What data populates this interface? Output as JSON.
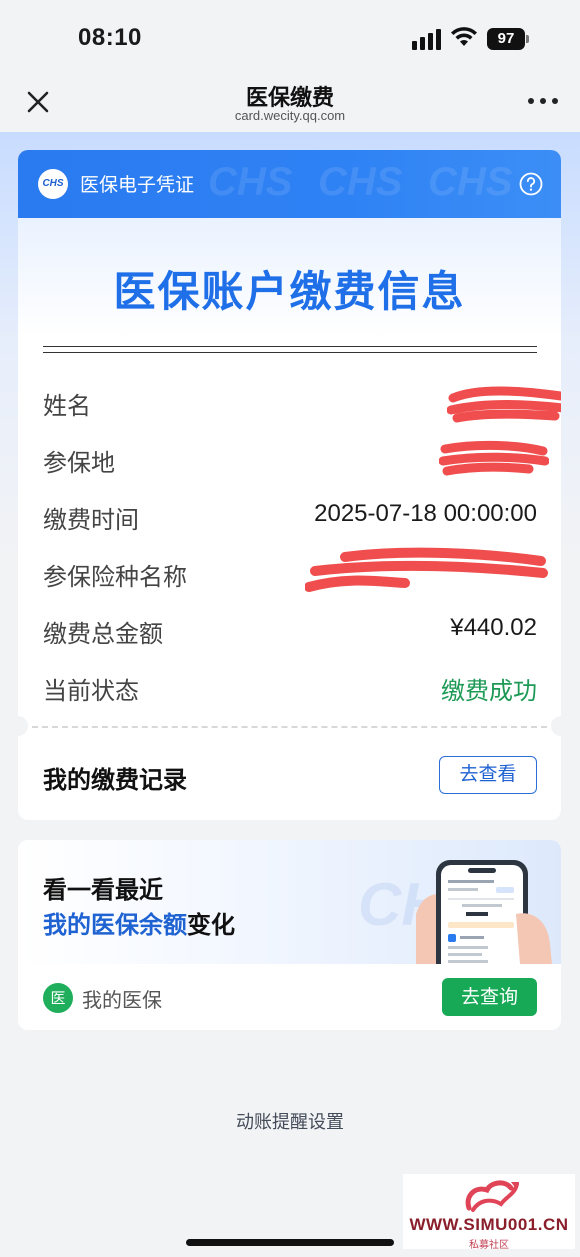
{
  "status_bar": {
    "time": "08:10",
    "battery": "97"
  },
  "nav": {
    "title": "医保缴费",
    "url": "card.wecity.qq.com"
  },
  "voucher": {
    "header_title": "医保电子凭证",
    "logo_text": "CHS",
    "heading": "医保账户缴费信息",
    "rows": [
      {
        "label": "姓名",
        "value": ""
      },
      {
        "label": "参保地",
        "value": ""
      },
      {
        "label": "缴费时间",
        "value": "2025-07-18 00:00:00"
      },
      {
        "label": "参保险种名称",
        "value": ""
      },
      {
        "label": "缴费总金额",
        "value": "¥440.02"
      },
      {
        "label": "当前状态",
        "value": "缴费成功"
      }
    ],
    "record_label": "我的缴费记录",
    "view_button": "去查看"
  },
  "balance": {
    "line1": "看一看最近",
    "line2_highlight": "我的医保余额",
    "line2_rest": "变化",
    "footer_icon_text": "医",
    "footer_label": "我的医保",
    "query_button": "去查询"
  },
  "bottom": {
    "reminder": "动账提醒设置",
    "watermark_site": "WWW.SIMU001.CN",
    "watermark_sub": "私募社区"
  },
  "colors": {
    "primary_blue": "#2a7af0",
    "success_green": "#1d9a55",
    "button_green": "#18a956",
    "redaction": "#f04e4e"
  }
}
